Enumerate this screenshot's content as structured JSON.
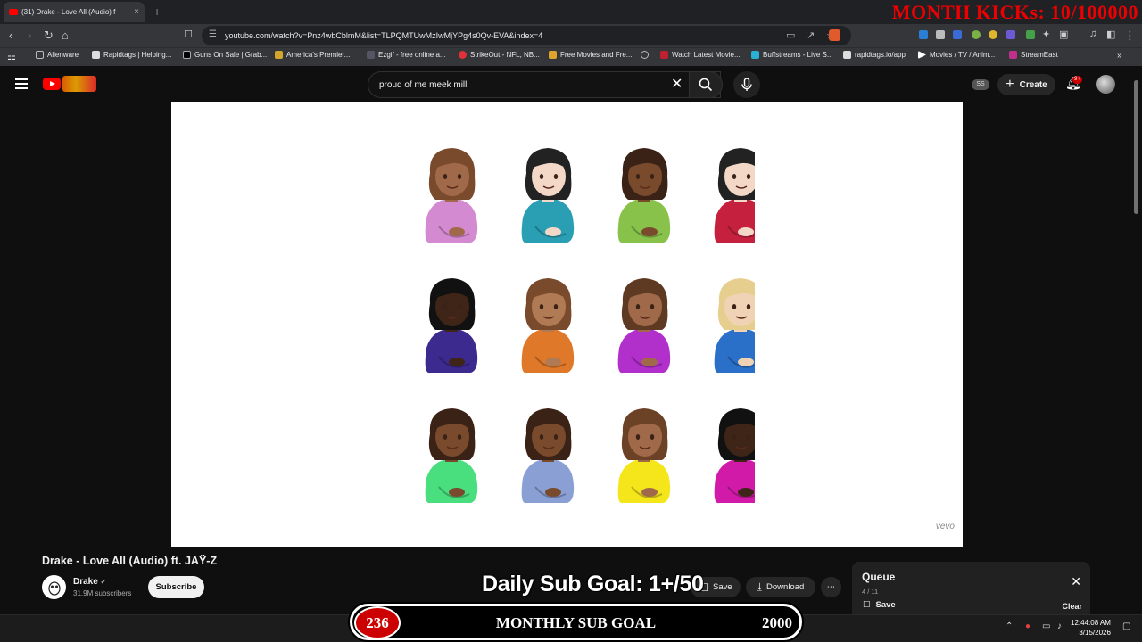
{
  "browser": {
    "tab_title": "(31) Drake - Love All (Audio) f",
    "url": "youtube.com/watch?v=Pnz4wbCblmM&list=TLPQMTUwMzIwMjYPg4s0Qv-EVA&index=4",
    "bookmarks": [
      "Alienware",
      "Rapidtags | Helping...",
      "Guns On Sale | Grab...",
      "America's Premier...",
      "Ezgif - free online a...",
      "StrikeOut - NFL, NB...",
      "Free Movies and Fre...",
      "Watch Latest Movie...",
      "Buffstreams - Live S...",
      "rapidtags.io/app",
      "Movies / TV / Anim...",
      "StreamEast"
    ]
  },
  "overlays": {
    "month_kicks": "MONTH KICKs: 10/100000",
    "daily_sub_goal": "Daily Sub Goal:  1+/50",
    "monthly_label": "MONTHLY SUB GOAL",
    "monthly_count": "236",
    "monthly_goal": "2000"
  },
  "youtube": {
    "search_value": "proud of me meek mill",
    "ss_label": "SS",
    "create_label": "Create",
    "notification_count": "9+",
    "vevo": "vevo",
    "video_title": "Drake - Love All (Audio) ft. JAŸ-Z",
    "channel_name": "Drake",
    "channel_subs": "31.9M subscribers",
    "subscribe_label": "Subscribe",
    "save_label": "Save",
    "download_label": "Download",
    "queue": {
      "title": "Queue",
      "count": "4 / 11",
      "save_label": "Save",
      "clear_label": "Clear"
    }
  },
  "taskbar": {
    "time": "12:44:08 AM",
    "date": "3/15/2026"
  },
  "emoji_grid": [
    {
      "skin": "#a0694a",
      "hair": "#7a4a2c",
      "shirt": "#d48ad0"
    },
    {
      "skin": "#f3d8c8",
      "hair": "#222",
      "shirt": "#2a9fb4"
    },
    {
      "skin": "#7a4a2c",
      "hair": "#3a2216",
      "shirt": "#89c24b"
    },
    {
      "skin": "#f3d8c8",
      "hair": "#222",
      "shirt": "#c5213f"
    },
    {
      "skin": "#3e2517",
      "hair": "#111",
      "shirt": "#3d2a8f"
    },
    {
      "skin": "#b07a54",
      "hair": "#7a4a2c",
      "shirt": "#e0782a"
    },
    {
      "skin": "#a0694a",
      "hair": "#5e3a22",
      "shirt": "#b12fcb"
    },
    {
      "skin": "#f0d2b4",
      "hair": "#e6cf8e",
      "shirt": "#2a6fc8"
    },
    {
      "skin": "#7a4a2c",
      "hair": "#3a2216",
      "shirt": "#49de7e"
    },
    {
      "skin": "#7a4a2c",
      "hair": "#3a2216",
      "shirt": "#8aa0d4"
    },
    {
      "skin": "#a0694a",
      "hair": "#6b4225",
      "shirt": "#f4e61b"
    },
    {
      "skin": "#3e2517",
      "hair": "#111",
      "shirt": "#d21aa8"
    }
  ]
}
